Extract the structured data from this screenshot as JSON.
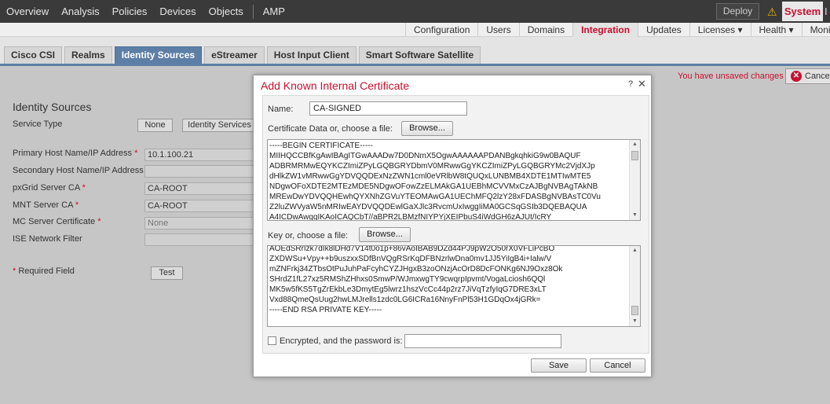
{
  "topnav": {
    "items": [
      "Overview",
      "Analysis",
      "Policies",
      "Devices",
      "Objects",
      "AMP"
    ],
    "deploy_label": "Deploy",
    "system_label": "System",
    "help_stub": "I"
  },
  "subnav": {
    "items": [
      "Configuration",
      "Users",
      "Domains",
      "Integration",
      "Updates",
      "Licenses ▾",
      "Health ▾",
      "Monito"
    ],
    "active": "Integration"
  },
  "tabs": {
    "items": [
      "Cisco CSI",
      "Realms",
      "Identity Sources",
      "eStreamer",
      "Host Input Client",
      "Smart Software Satellite"
    ],
    "active": "Identity Sources"
  },
  "page": {
    "unsaved": "You have unsaved changes",
    "cancel_label": "Cancel",
    "title": "Identity Sources",
    "service_type_label": "Service Type",
    "service_none": "None",
    "service_identity": "Identity Services",
    "primary_host_label": "Primary Host Name/IP Address",
    "primary_host_value": "10.1.100.21",
    "secondary_host_label": "Secondary Host Name/IP Address",
    "pxgrid_ca_label": "pxGrid Server CA",
    "pxgrid_ca_value": "CA-ROOT",
    "mnt_ca_label": "MNT Server CA",
    "mnt_ca_value": "CA-ROOT",
    "mc_cert_label": "MC Server Certificate",
    "mc_cert_value": "None",
    "ise_filter_label": "ISE Network Filter",
    "required_label": "Required Field",
    "test_label": "Test"
  },
  "modal": {
    "title": "Add Known Internal Certificate",
    "help": "?",
    "close": "✕",
    "name_label": "Name:",
    "name_value": "CA-SIGNED",
    "cert_label": "Certificate Data or, choose a file:",
    "key_label": "Key or, choose a file:",
    "browse_label": "Browse...",
    "cert_text": "-----BEGIN CERTIFICATE-----\nMIIHQCCBfKgAwIBAgITGwAAADw7D0DNmX5OgwAAAAAAPDANBgkqhkiG9w0BAQUF\nADBRMRMwEQYKCZImiZPyLGQBGRYDbmV0MRwwGgYKCZImiZPyLGQBGRYMc2VjdXJp\ndHlkZW1vMRwwGgYDVQQDExNzZWN1cml0eVRlbW8tQUQxLUNBMB4XDTE1MTIwMTE5\nNDgwOFoXDTE2MTEzMDE5NDgwOFowZzELMAkGA1UEBhMCVVMxCzAJBgNVBAgTAkNB\nMREwDwYDVQQHEwhQYXNhZGVuYTEOMAwGA1UEChMFQ2lzY28xFDASBgNVBAsTC0Vu\nZ2luZWVyaW5nMRIwEAYDVQQDEwlGaXJlc3RvcmUxIwggIiMA0GCSqGSIb3DQEBAQUA\nA4ICDwAwggIKAoICAQCbT//aBPR2LBMzfNIYPYjXEIPbuS4iWdGH6zAJUt/IcRY",
    "key_text": "AOEdSRrIzk7dIk8lDHd7V14t0o1p+86vAoIBAB9DZd44PJ9pW2O50rX0VFLiPcBO\nZXDWSu+Vpy++b9uszxxSDfBnVQgRSrKqDFBNzrlwDna0mv1JJ5YiIgB4i+Ialw/V\nmZNFrkj34ZTbsOtPuJuhPaFcyhCYZJHgxB3zoONzjAcOrD8DcFONKg6NJ9Oxz8Ok\nSHrdZ1fL27xz5RMShZHhxs0SmwP/WJmxwgTY9cwqrpIpvmt/VogaLciosh6QQl\nMK5w5fKS5TgZrEkbLe3DmytEg5lwrz1hszVcCc44p2rz7JiVqTzfyIqG7DRE3xLT\nVxd88QmeQsUug2hwLMJrells1zdc0LG6ICRa16NnyFnPl53H1GDqOx4jGRk=\n-----END RSA PRIVATE KEY-----",
    "encrypted_label": "Encrypted, and the password is:",
    "save_label": "Save",
    "cancel_label": "Cancel"
  },
  "icons": {
    "warning": "warning-icon",
    "close": "close-icon"
  },
  "colors": {
    "accent": "#c8102e",
    "tab_active": "#5d7fa6",
    "topnav_bg": "#3a3a3a"
  }
}
